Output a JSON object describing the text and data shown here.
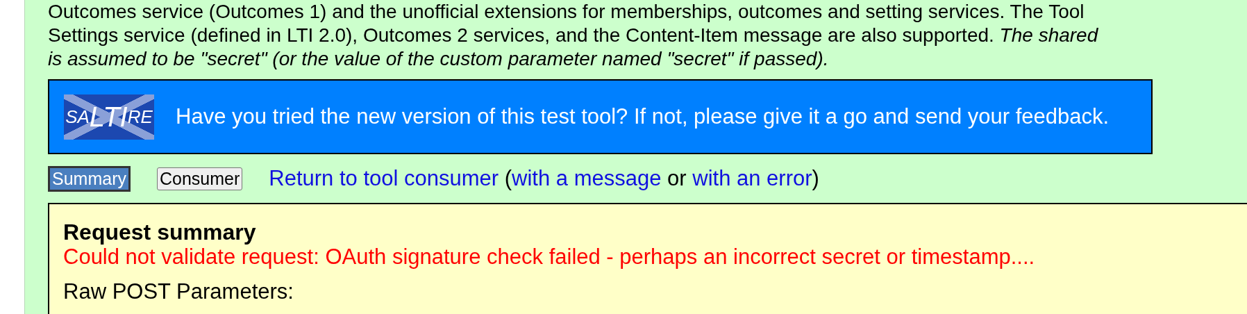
{
  "intro": {
    "lines": [
      {
        "text": "Outcomes service (Outcomes 1) and the unofficial extensions for memberships, outcomes and setting services. The Tool",
        "italic": false
      },
      {
        "text": "Settings service (defined in LTI 2.0), Outcomes 2 services, and the Content-Item message are also supported. *The shared*",
        "italic": false
      },
      {
        "text": "is assumed to be \"secret\" (or the value of the custom parameter named \"secret\" if passed).",
        "italic": true
      }
    ]
  },
  "banner": {
    "logo": [
      {
        "text": "SA",
        "kind": "small"
      },
      {
        "text": "LTI",
        "kind": "large"
      },
      {
        "text": "RE",
        "kind": "small"
      }
    ],
    "message": "Have you tried the new version of this test tool? If not, please give it a go and send your feedback."
  },
  "tabs": [
    {
      "label": "Summary",
      "selected": true
    },
    {
      "label": "Consumer",
      "selected": false
    }
  ],
  "return_links": [
    {
      "kind": "link",
      "text": "Return to tool consumer"
    },
    {
      "kind": "text",
      "text": " ("
    },
    {
      "kind": "link",
      "text": "with a message"
    },
    {
      "kind": "text",
      "text": " or "
    },
    {
      "kind": "link",
      "text": "with an error"
    },
    {
      "kind": "text",
      "text": ")"
    }
  ],
  "summary": {
    "title": "Request summary",
    "error": "Could not validate request: OAuth signature check failed - perhaps an incorrect secret or timestamp....",
    "raw_label": "Raw POST Parameters:"
  }
}
